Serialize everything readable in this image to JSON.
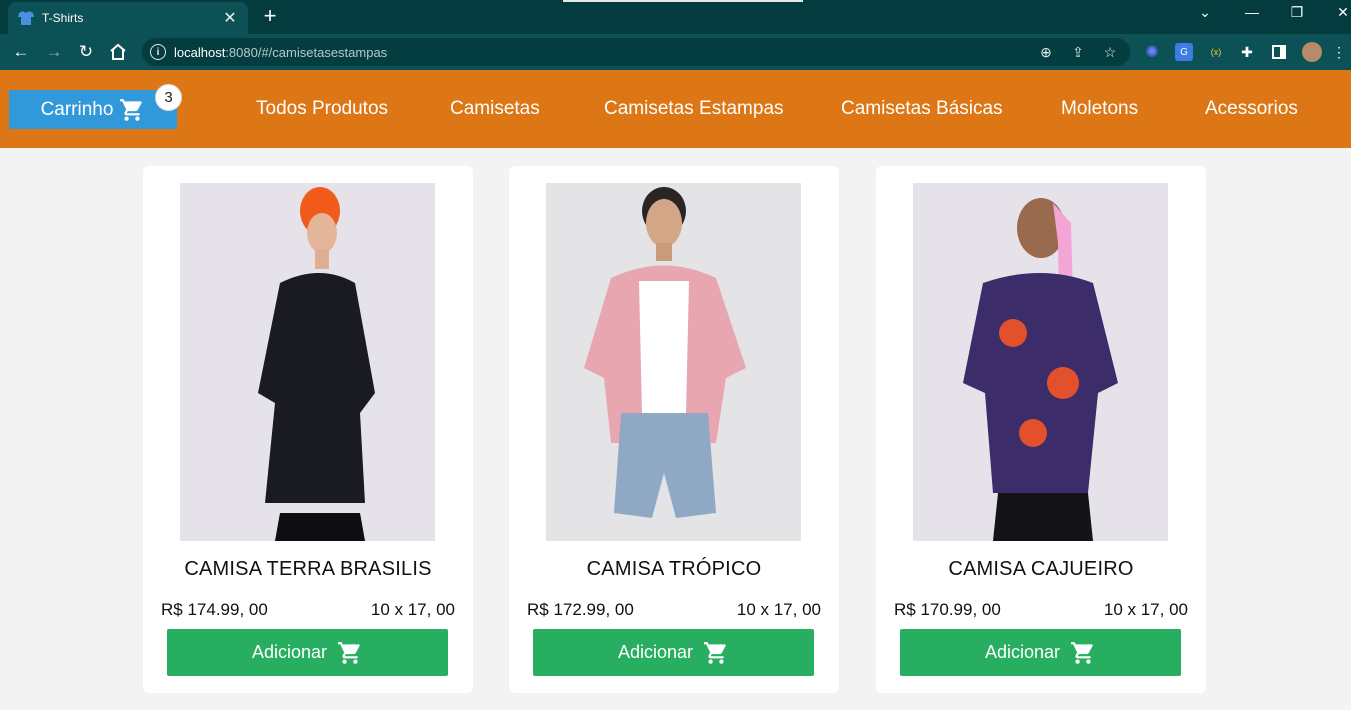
{
  "browser": {
    "tab_title": "T-Shirts",
    "url_host": "localhost",
    "url_rest": ":8080/#/camisetasestampas",
    "colors": {
      "tabbar": "#033b3e",
      "toolbar": "#0b5156"
    }
  },
  "header": {
    "cart_label": "Carrinho",
    "cart_count": "3",
    "nav": [
      "Todos Produtos",
      "Camisetas",
      "Camisetas Estampas",
      "Camisetas Básicas",
      "Moletons",
      "Acessorios"
    ],
    "colors": {
      "nav_bg": "#dd7716",
      "cart_bg": "#3199d9"
    }
  },
  "products": [
    {
      "name": "CAMISA TERRA BRASILIS",
      "price": "R$ 174.99, 00",
      "installments": "10 x 17, 00",
      "button": "Adicionar"
    },
    {
      "name": "CAMISA TRÓPICO",
      "price": "R$ 172.99, 00",
      "installments": "10 x 17, 00",
      "button": "Adicionar"
    },
    {
      "name": "CAMISA CAJUEIRO",
      "price": "R$ 170.99, 00",
      "installments": "10 x 17, 00",
      "button": "Adicionar"
    }
  ],
  "colors": {
    "add_button": "#27ae60"
  }
}
